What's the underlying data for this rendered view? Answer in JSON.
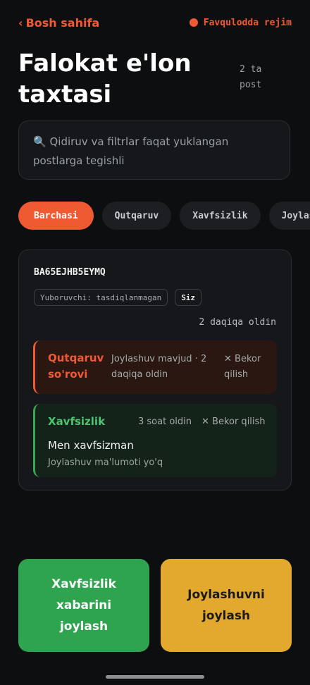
{
  "topbar": {
    "back_label": "Bosh sahifa",
    "back_chevron": "‹",
    "mode_label": "Favqulodda rejim"
  },
  "page": {
    "title": "Falokat e'lon taxtasi",
    "post_count": "2 ta post"
  },
  "search": {
    "icon": "🔍",
    "text": "Qidiruv va filtrlar faqat yuklangan postlarga tegishli"
  },
  "filters": [
    {
      "label": "Barchasi",
      "active": true
    },
    {
      "label": "Qutqaruv",
      "active": false
    },
    {
      "label": "Xavfsizlik",
      "active": false
    },
    {
      "label": "Joylashuv",
      "active": false
    }
  ],
  "card": {
    "code": "BA65EJHB5EYMQ",
    "sender_label": "Yuboruvchi: tasdiqlanmagan",
    "self_label": "Siz",
    "time": "2 daqiqa oldin",
    "messages": [
      {
        "type": "Qutqaruv so'rovi",
        "meta": "Joylashuv mavjud · 2 daqiqa oldin",
        "cancel": "✕ Bekor qilish"
      },
      {
        "type": "Xavfsizlik",
        "meta": "3 soat oldin",
        "cancel": "✕ Bekor qilish",
        "body": "Men xavfsizman",
        "location": "Joylashuv ma'lumoti yo'q"
      }
    ]
  },
  "actions": {
    "safe_button": "Xavfsizlik xabarini joylash",
    "location_button": "Joylashuvni joylash"
  },
  "colors": {
    "accent": "#f05a33",
    "safe": "#2ea44f",
    "warning": "#e3a92e"
  }
}
